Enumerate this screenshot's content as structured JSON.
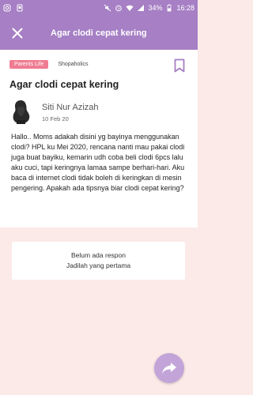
{
  "status_bar": {
    "battery": "34%",
    "time": "16:28"
  },
  "app_bar": {
    "title": "Agar clodi cepat kering"
  },
  "post": {
    "tag_primary": "Parents Life",
    "tag_secondary": "Shopaholics",
    "title": "Agar clodi cepat kering",
    "author_name": "Siti Nur Azizah",
    "date": "10 Feb 20",
    "body": "Hallo.. Moms adakah disini yg bayinya menggunakan clodi? HPL ku Mei 2020, rencana nanti mau pakai clodi juga buat bayiku, kemarin udh coba beli clodi 6pcs lalu aku cuci, tapi keringnya lamaa sampe berhari-hari. Aku baca di internet clodi tidak boleh di keringkan di mesin pengering. Apakah ada tipsnya biar clodi cepat kering?"
  },
  "responses": {
    "empty_line1": "Belum ada respon",
    "empty_line2": "Jadilah yang pertama"
  },
  "icons": {
    "close": "close-icon",
    "bookmark": "bookmark-icon",
    "share": "share-icon"
  },
  "colors": {
    "app_bar": "#a67fc4",
    "tag": "#ef7c92",
    "fab": "#c3a4d8",
    "background": "#fbeae8"
  }
}
